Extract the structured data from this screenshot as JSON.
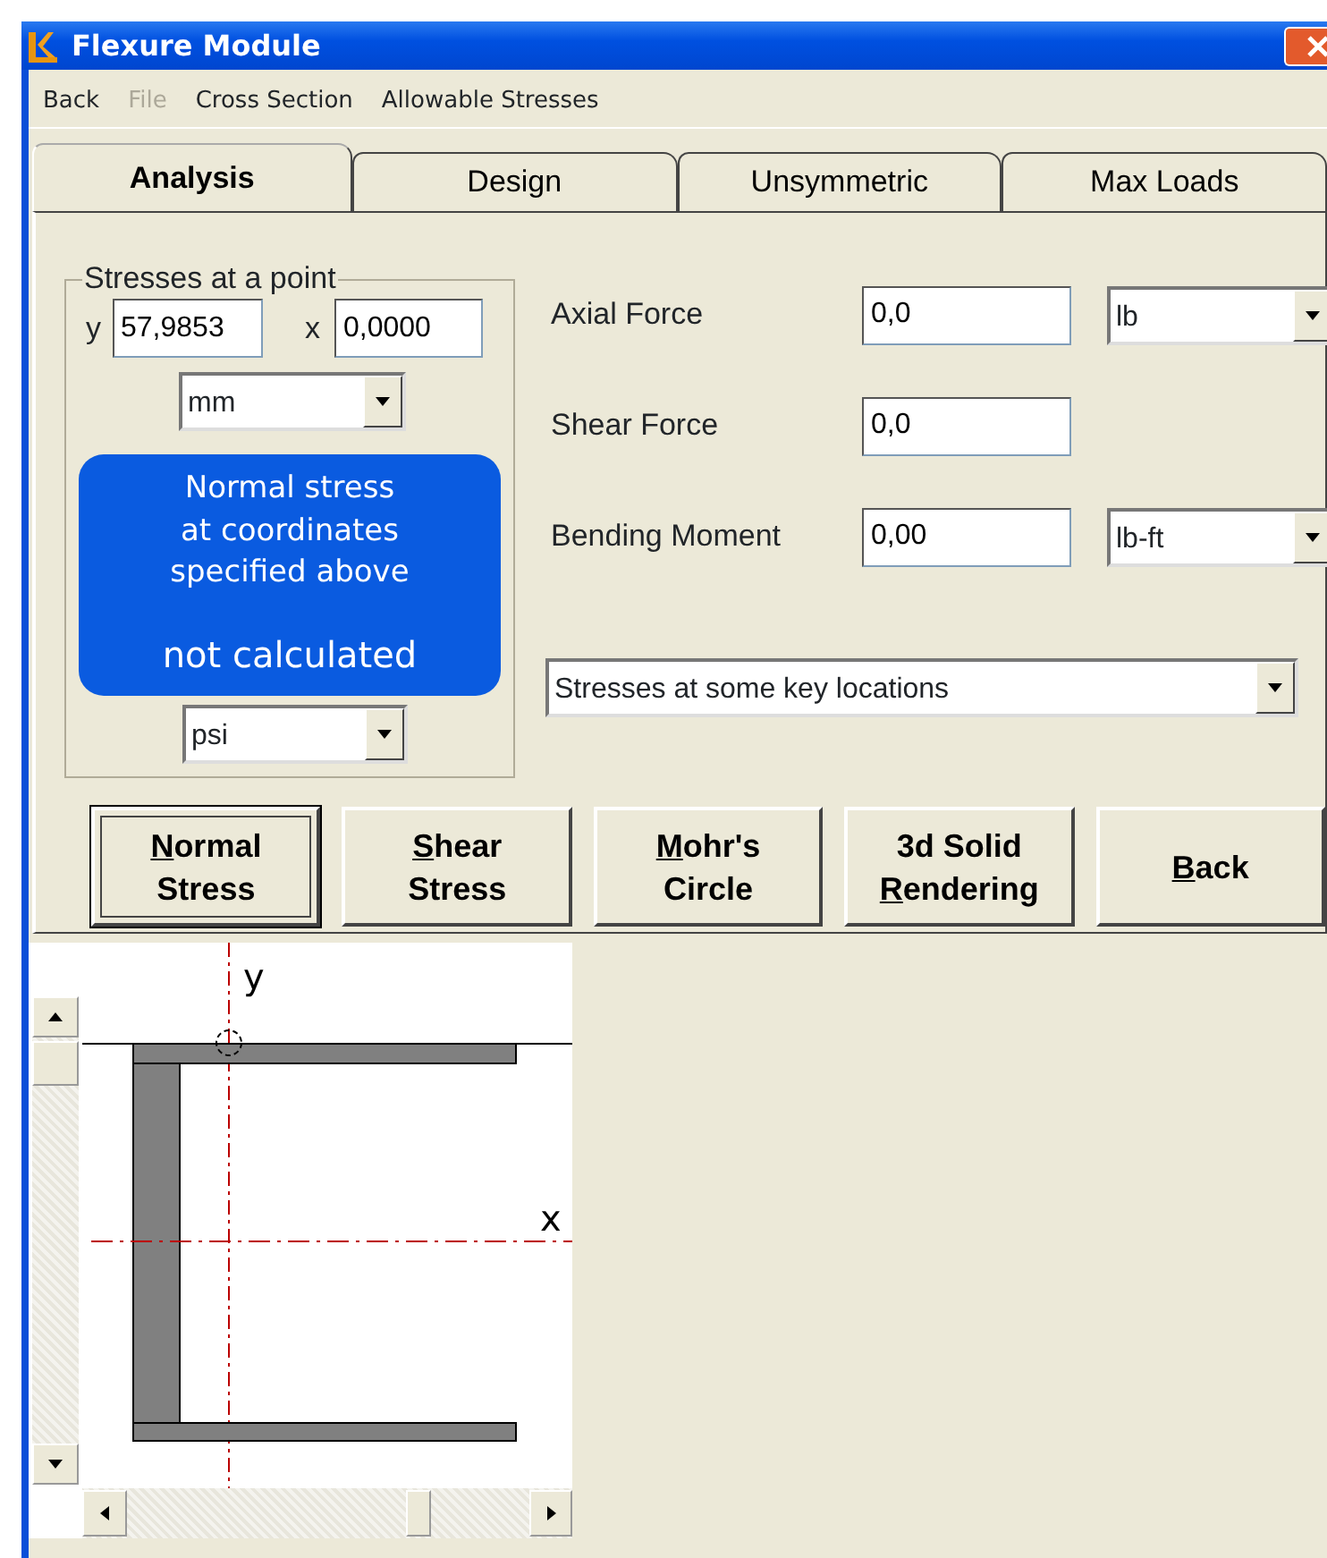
{
  "window": {
    "title": "Flexure Module"
  },
  "menu": [
    {
      "label": "Back",
      "disabled": false
    },
    {
      "label": "File",
      "disabled": true
    },
    {
      "label": "Cross Section",
      "disabled": false
    },
    {
      "label": "Allowable Stresses",
      "disabled": false
    }
  ],
  "tabs": [
    {
      "label": "Analysis",
      "selected": true
    },
    {
      "label": "Design",
      "selected": false
    },
    {
      "label": "Unsymmetric",
      "selected": false
    },
    {
      "label": "Max Loads",
      "selected": false
    }
  ],
  "point_group": {
    "title": "Stresses at a point",
    "y_label": "y",
    "y_value": "57,9853",
    "x_label": "x",
    "x_value": "0,0000",
    "length_unit": "mm",
    "result": {
      "caption": [
        "Normal stress",
        "at coordinates",
        "specified above"
      ],
      "value": "not calculated"
    },
    "stress_unit": "psi"
  },
  "loads": [
    {
      "label": "Axial Force",
      "value": "0,0",
      "unit": "lb"
    },
    {
      "label": "Shear Force",
      "value": "0,0"
    },
    {
      "label": "Bending Moment",
      "value": "0,00",
      "unit": "lb-ft"
    }
  ],
  "view_select": "Stresses at some key locations",
  "buttons": [
    {
      "lines": [
        {
          "text": "Normal",
          "mnemonic": true
        },
        {
          "text": "Stress",
          "mnemonic": false
        }
      ],
      "default": true
    },
    {
      "lines": [
        {
          "text": "Shear",
          "mnemonic": true
        },
        {
          "text": "Stress",
          "mnemonic": false
        }
      ],
      "default": false
    },
    {
      "lines": [
        {
          "text": "Mohr's",
          "mnemonic": true
        },
        {
          "text": "Circle",
          "mnemonic": false
        }
      ],
      "default": false
    },
    {
      "lines": [
        {
          "text": "3d Solid",
          "mnemonic": false
        },
        {
          "text": "Rendering",
          "mnemonic": true
        }
      ],
      "default": false
    },
    {
      "lines": [
        {
          "text": "Back",
          "mnemonic": true
        }
      ],
      "default": false
    }
  ],
  "section_view": {
    "y_axis_label": "y",
    "x_axis_label": "x"
  }
}
